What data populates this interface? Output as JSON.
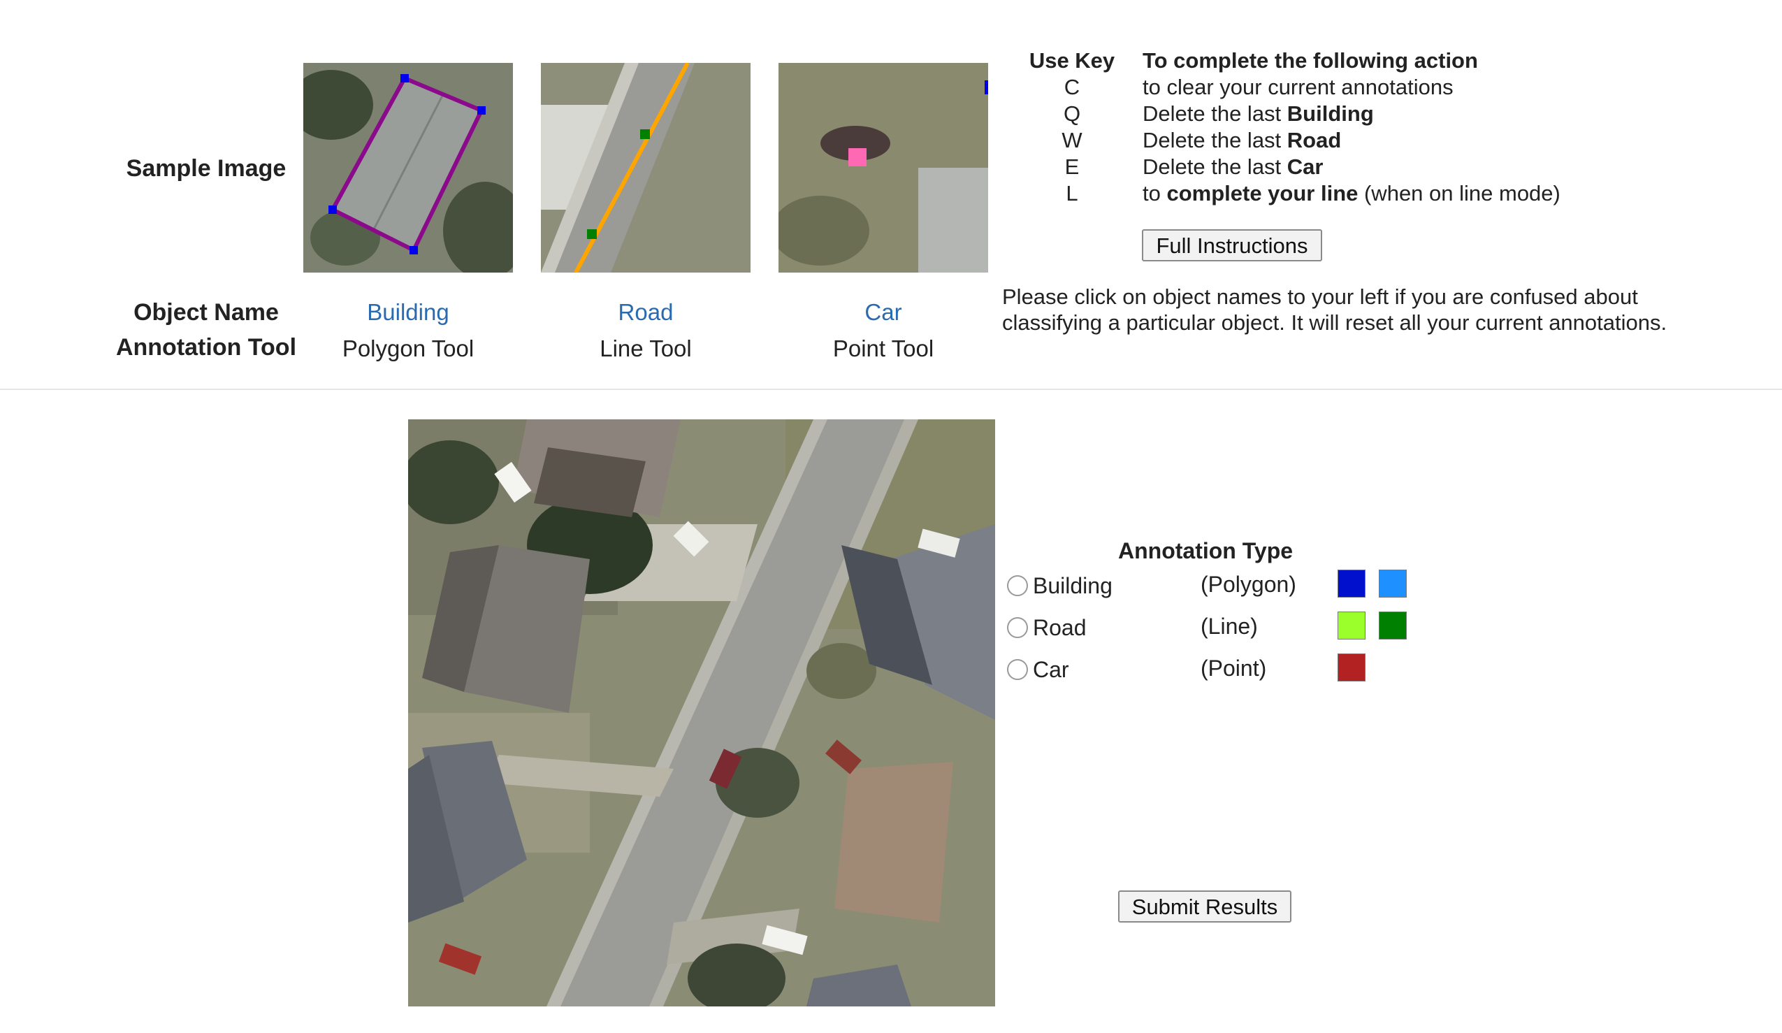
{
  "samples": {
    "row_labels": {
      "sample_image": "Sample Image",
      "object_name": "Object Name",
      "annotation_tool": "Annotation Tool"
    },
    "items": [
      {
        "object": "Building",
        "tool": "Polygon Tool"
      },
      {
        "object": "Road",
        "tool": "Line Tool"
      },
      {
        "object": "Car",
        "tool": "Point Tool"
      }
    ]
  },
  "keys": {
    "header_key": "Use Key",
    "header_action": "To complete the following action",
    "rows": [
      {
        "key": "C",
        "pre": "to clear your current annotations",
        "bold": "",
        "post": ""
      },
      {
        "key": "Q",
        "pre": "Delete the last ",
        "bold": "Building",
        "post": ""
      },
      {
        "key": "W",
        "pre": "Delete the last ",
        "bold": "Road",
        "post": ""
      },
      {
        "key": "E",
        "pre": "Delete the last ",
        "bold": "Car",
        "post": ""
      },
      {
        "key": "L",
        "pre": "to ",
        "bold": "complete your line",
        "post": " (when on line mode)"
      }
    ]
  },
  "buttons": {
    "full_instructions": "Full Instructions",
    "submit": "Submit Results"
  },
  "help_text": {
    "line1": "Please click on object names to your left if you are confused about",
    "line2": "classifying a particular object. It will reset all your current annotations."
  },
  "annotation": {
    "title": "Annotation Type",
    "options": [
      {
        "label": "Building",
        "type": "(Polygon)",
        "colors": [
          "#0010cc",
          "#1e90ff"
        ]
      },
      {
        "label": "Road",
        "type": "(Line)",
        "colors": [
          "#9aff2a",
          "#008000"
        ]
      },
      {
        "label": "Car",
        "type": "(Point)",
        "colors": [
          "#b22222"
        ]
      }
    ]
  }
}
